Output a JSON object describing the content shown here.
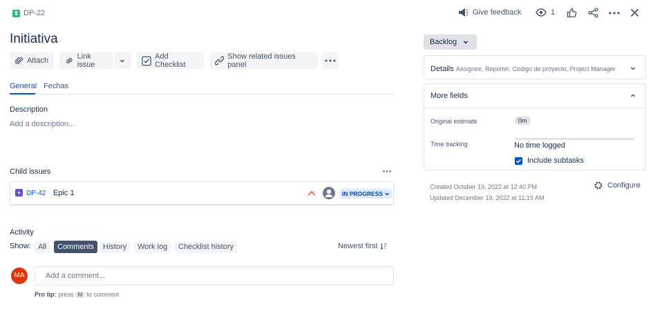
{
  "header": {
    "issue_key": "DP-22",
    "give_feedback": "Give feedback",
    "watch_count": "1"
  },
  "issue": {
    "title": "Initiativa"
  },
  "toolbar": {
    "attach": "Attach",
    "link_issue": "Link issue",
    "add_checklist": "Add Checklist",
    "show_related": "Show related issues panel"
  },
  "tabs": [
    {
      "label": "General",
      "active": true
    },
    {
      "label": "Fechas",
      "active": false
    }
  ],
  "description": {
    "label": "Description",
    "placeholder": "Add a description..."
  },
  "child_issues": {
    "label": "Child issues",
    "items": [
      {
        "key": "DP-42",
        "summary": "Epic 1",
        "status": "IN PROGRESS",
        "priority_icon": "priority-high-icon",
        "type_icon": "epic-icon"
      }
    ]
  },
  "activity": {
    "label": "Activity",
    "show_label": "Show:",
    "filters": [
      {
        "label": "All",
        "selected": false
      },
      {
        "label": "Comments",
        "selected": true
      },
      {
        "label": "History",
        "selected": false
      },
      {
        "label": "Work log",
        "selected": false
      },
      {
        "label": "Checklist history",
        "selected": false
      }
    ],
    "sort": "Newest first",
    "avatar_initials": "MA",
    "comment_placeholder": "Add a comment...",
    "pro_tip_prefix": "Pro tip:",
    "pro_tip_press": "press",
    "pro_tip_key": "M",
    "pro_tip_suffix": "to comment"
  },
  "sidebar": {
    "status": "Backlog",
    "details_label": "Details",
    "details_summary": "Assignee, Reporter, Código de proyecto, Project Manager",
    "more_fields_label": "More fields",
    "original_estimate_label": "Original estimate",
    "original_estimate_value": "0m",
    "time_tracking_label": "Time tracking",
    "time_tracking_value": "No time logged",
    "include_subtasks_label": "Include subtasks",
    "include_subtasks_checked": true,
    "created": "Created October 19, 2022 at 12:40 PM",
    "updated": "Updated December 19, 2022 at 11:19 AM",
    "configure": "Configure"
  },
  "colors": {
    "accent": "#0052cc",
    "epic": "#6554c0",
    "story": "#36b37e",
    "priority_high": "#ff5630",
    "status_bg": "#deebff",
    "status_text": "#0747a6",
    "avatar": "#de350b"
  }
}
